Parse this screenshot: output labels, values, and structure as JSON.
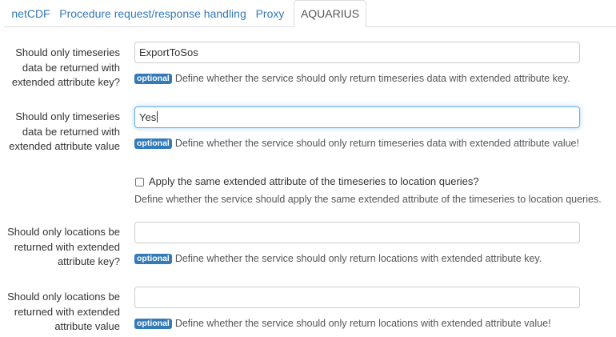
{
  "tabs": [
    {
      "label": "netCDF",
      "active": false
    },
    {
      "label": "Procedure request/response handling",
      "active": false
    },
    {
      "label": "Proxy",
      "active": false
    },
    {
      "label": "AQUARIUS",
      "active": true
    }
  ],
  "optional_badge": "optional",
  "fields": [
    {
      "label_lines": [
        "Should only timeseries",
        "data be returned with",
        "extended attribute key?"
      ],
      "value": "ExportToSos",
      "placeholder": "",
      "help": "Define whether the service should only return timeseries data with extended attribute key."
    },
    {
      "label_lines": [
        "Should only timeseries",
        "data be returned with",
        "extended attribute value"
      ],
      "value": "Yes",
      "placeholder": "",
      "focused": true,
      "help": "Define whether the service should only return timeseries data with extended attribute value!"
    },
    {
      "label_lines": [
        "Should only locations be",
        "returned with extended",
        "attribute key?"
      ],
      "value": "",
      "placeholder": "",
      "help": "Define whether the service should only return locations with extended attribute key."
    },
    {
      "label_lines": [
        "Should only locations be",
        "returned with extended",
        "attribute value"
      ],
      "value": "",
      "placeholder": "",
      "help": "Define whether the service should only return locations with extended attribute value!"
    }
  ],
  "checkbox_option": {
    "label": "Apply the same extended attribute of the timeseries to location queries?",
    "checked": false,
    "help": "Define whether the service should apply the same extended attribute of the timeseries to location queries."
  },
  "colors": {
    "link": "#337ab7",
    "badge": "#337ab7",
    "focus_border": "#66afe9",
    "border": "#cccccc"
  }
}
